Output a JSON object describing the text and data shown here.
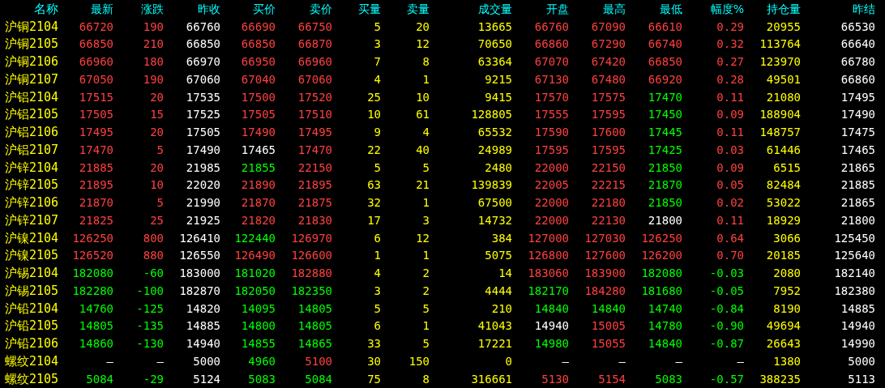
{
  "table": {
    "columns": [
      "名称",
      "最新",
      "涨跌",
      "昨收",
      "买价",
      "卖价",
      "买量",
      "卖量",
      "成交量",
      "开盘",
      "最高",
      "最低",
      "幅度%",
      "持仓量",
      "昨结"
    ],
    "rows": [
      {
        "cells": [
          {
            "text": "沪铜2104",
            "color": "#ffff00"
          },
          {
            "text": "66720",
            "color": "#ff4040"
          },
          {
            "text": "190",
            "color": "#ff4040"
          },
          {
            "text": "66760",
            "color": "#ffffff"
          },
          {
            "text": "66690",
            "color": "#ff4040"
          },
          {
            "text": "66750",
            "color": "#ff4040"
          },
          {
            "text": "5",
            "color": "#ffff00"
          },
          {
            "text": "20",
            "color": "#ffff00"
          },
          {
            "text": "13665",
            "color": "#ffff00"
          },
          {
            "text": "66760",
            "color": "#ff4040"
          },
          {
            "text": "67090",
            "color": "#ff4040"
          },
          {
            "text": "66610",
            "color": "#ff4040"
          },
          {
            "text": "0.29",
            "color": "#ff4040"
          },
          {
            "text": "20955",
            "color": "#ffff00"
          },
          {
            "text": "66530",
            "color": "#ffffff"
          }
        ]
      },
      {
        "cells": [
          {
            "text": "沪铜2105",
            "color": "#ffff00"
          },
          {
            "text": "66850",
            "color": "#ff4040"
          },
          {
            "text": "210",
            "color": "#ff4040"
          },
          {
            "text": "66850",
            "color": "#ffffff"
          },
          {
            "text": "66850",
            "color": "#ff4040"
          },
          {
            "text": "66870",
            "color": "#ff4040"
          },
          {
            "text": "3",
            "color": "#ffff00"
          },
          {
            "text": "12",
            "color": "#ffff00"
          },
          {
            "text": "70650",
            "color": "#ffff00"
          },
          {
            "text": "66860",
            "color": "#ff4040"
          },
          {
            "text": "67290",
            "color": "#ff4040"
          },
          {
            "text": "66740",
            "color": "#ff4040"
          },
          {
            "text": "0.32",
            "color": "#ff4040"
          },
          {
            "text": "113764",
            "color": "#ffff00"
          },
          {
            "text": "66640",
            "color": "#ffffff"
          }
        ]
      },
      {
        "cells": [
          {
            "text": "沪铜2106",
            "color": "#ffff00"
          },
          {
            "text": "66960",
            "color": "#ff4040"
          },
          {
            "text": "180",
            "color": "#ff4040"
          },
          {
            "text": "66970",
            "color": "#ffffff"
          },
          {
            "text": "66950",
            "color": "#ff4040"
          },
          {
            "text": "66960",
            "color": "#ff4040"
          },
          {
            "text": "7",
            "color": "#ffff00"
          },
          {
            "text": "8",
            "color": "#ffff00"
          },
          {
            "text": "63364",
            "color": "#ffff00"
          },
          {
            "text": "67070",
            "color": "#ff4040"
          },
          {
            "text": "67420",
            "color": "#ff4040"
          },
          {
            "text": "66850",
            "color": "#ff4040"
          },
          {
            "text": "0.27",
            "color": "#ff4040"
          },
          {
            "text": "123970",
            "color": "#ffff00"
          },
          {
            "text": "66780",
            "color": "#ffffff"
          }
        ]
      },
      {
        "cells": [
          {
            "text": "沪铜2107",
            "color": "#ffff00"
          },
          {
            "text": "67050",
            "color": "#ff4040"
          },
          {
            "text": "190",
            "color": "#ff4040"
          },
          {
            "text": "67060",
            "color": "#ffffff"
          },
          {
            "text": "67040",
            "color": "#ff4040"
          },
          {
            "text": "67060",
            "color": "#ff4040"
          },
          {
            "text": "4",
            "color": "#ffff00"
          },
          {
            "text": "1",
            "color": "#ffff00"
          },
          {
            "text": "9215",
            "color": "#ffff00"
          },
          {
            "text": "67130",
            "color": "#ff4040"
          },
          {
            "text": "67480",
            "color": "#ff4040"
          },
          {
            "text": "66920",
            "color": "#ff4040"
          },
          {
            "text": "0.28",
            "color": "#ff4040"
          },
          {
            "text": "49501",
            "color": "#ffff00"
          },
          {
            "text": "66860",
            "color": "#ffffff"
          }
        ]
      },
      {
        "cells": [
          {
            "text": "沪铝2104",
            "color": "#ffff00"
          },
          {
            "text": "17515",
            "color": "#ff4040"
          },
          {
            "text": "20",
            "color": "#ff4040"
          },
          {
            "text": "17535",
            "color": "#ffffff"
          },
          {
            "text": "17500",
            "color": "#ff4040"
          },
          {
            "text": "17520",
            "color": "#ff4040"
          },
          {
            "text": "25",
            "color": "#ffff00"
          },
          {
            "text": "10",
            "color": "#ffff00"
          },
          {
            "text": "9415",
            "color": "#ffff00"
          },
          {
            "text": "17570",
            "color": "#ff4040"
          },
          {
            "text": "17575",
            "color": "#ff4040"
          },
          {
            "text": "17470",
            "color": "#00ff00"
          },
          {
            "text": "0.11",
            "color": "#ff4040"
          },
          {
            "text": "21080",
            "color": "#ffff00"
          },
          {
            "text": "17495",
            "color": "#ffffff"
          }
        ]
      },
      {
        "cells": [
          {
            "text": "沪铝2105",
            "color": "#ffff00"
          },
          {
            "text": "17505",
            "color": "#ff4040"
          },
          {
            "text": "15",
            "color": "#ff4040"
          },
          {
            "text": "17525",
            "color": "#ffffff"
          },
          {
            "text": "17505",
            "color": "#ff4040"
          },
          {
            "text": "17510",
            "color": "#ff4040"
          },
          {
            "text": "10",
            "color": "#ffff00"
          },
          {
            "text": "61",
            "color": "#ffff00"
          },
          {
            "text": "128805",
            "color": "#ffff00"
          },
          {
            "text": "17555",
            "color": "#ff4040"
          },
          {
            "text": "17595",
            "color": "#ff4040"
          },
          {
            "text": "17450",
            "color": "#00ff00"
          },
          {
            "text": "0.09",
            "color": "#ff4040"
          },
          {
            "text": "188904",
            "color": "#ffff00"
          },
          {
            "text": "17490",
            "color": "#ffffff"
          }
        ]
      },
      {
        "cells": [
          {
            "text": "沪铝2106",
            "color": "#ffff00"
          },
          {
            "text": "17495",
            "color": "#ff4040"
          },
          {
            "text": "20",
            "color": "#ff4040"
          },
          {
            "text": "17505",
            "color": "#ffffff"
          },
          {
            "text": "17490",
            "color": "#ff4040"
          },
          {
            "text": "17495",
            "color": "#ff4040"
          },
          {
            "text": "9",
            "color": "#ffff00"
          },
          {
            "text": "4",
            "color": "#ffff00"
          },
          {
            "text": "65532",
            "color": "#ffff00"
          },
          {
            "text": "17590",
            "color": "#ff4040"
          },
          {
            "text": "17600",
            "color": "#ff4040"
          },
          {
            "text": "17445",
            "color": "#00ff00"
          },
          {
            "text": "0.11",
            "color": "#ff4040"
          },
          {
            "text": "148757",
            "color": "#ffff00"
          },
          {
            "text": "17475",
            "color": "#ffffff"
          }
        ]
      },
      {
        "cells": [
          {
            "text": "沪铝2107",
            "color": "#ffff00"
          },
          {
            "text": "17470",
            "color": "#ff4040"
          },
          {
            "text": "5",
            "color": "#ff4040"
          },
          {
            "text": "17490",
            "color": "#ffffff"
          },
          {
            "text": "17465",
            "color": "#ffffff"
          },
          {
            "text": "17470",
            "color": "#ff4040"
          },
          {
            "text": "22",
            "color": "#ffff00"
          },
          {
            "text": "40",
            "color": "#ffff00"
          },
          {
            "text": "24989",
            "color": "#ffff00"
          },
          {
            "text": "17595",
            "color": "#ff4040"
          },
          {
            "text": "17595",
            "color": "#ff4040"
          },
          {
            "text": "17425",
            "color": "#00ff00"
          },
          {
            "text": "0.03",
            "color": "#ff4040"
          },
          {
            "text": "61446",
            "color": "#ffff00"
          },
          {
            "text": "17465",
            "color": "#ffffff"
          }
        ]
      },
      {
        "cells": [
          {
            "text": "沪锌2104",
            "color": "#ffff00"
          },
          {
            "text": "21885",
            "color": "#ff4040"
          },
          {
            "text": "20",
            "color": "#ff4040"
          },
          {
            "text": "21985",
            "color": "#ffffff"
          },
          {
            "text": "21855",
            "color": "#00ff00"
          },
          {
            "text": "22150",
            "color": "#ff4040"
          },
          {
            "text": "5",
            "color": "#ffff00"
          },
          {
            "text": "5",
            "color": "#ffff00"
          },
          {
            "text": "2480",
            "color": "#ffff00"
          },
          {
            "text": "22000",
            "color": "#ff4040"
          },
          {
            "text": "22150",
            "color": "#ff4040"
          },
          {
            "text": "21850",
            "color": "#00ff00"
          },
          {
            "text": "0.09",
            "color": "#ff4040"
          },
          {
            "text": "6515",
            "color": "#ffff00"
          },
          {
            "text": "21865",
            "color": "#ffffff"
          }
        ]
      },
      {
        "cells": [
          {
            "text": "沪锌2105",
            "color": "#ffff00"
          },
          {
            "text": "21895",
            "color": "#ff4040"
          },
          {
            "text": "10",
            "color": "#ff4040"
          },
          {
            "text": "22020",
            "color": "#ffffff"
          },
          {
            "text": "21890",
            "color": "#ff4040"
          },
          {
            "text": "21895",
            "color": "#ff4040"
          },
          {
            "text": "63",
            "color": "#ffff00"
          },
          {
            "text": "21",
            "color": "#ffff00"
          },
          {
            "text": "139839",
            "color": "#ffff00"
          },
          {
            "text": "22005",
            "color": "#ff4040"
          },
          {
            "text": "22215",
            "color": "#ff4040"
          },
          {
            "text": "21870",
            "color": "#00ff00"
          },
          {
            "text": "0.05",
            "color": "#ff4040"
          },
          {
            "text": "82484",
            "color": "#ffff00"
          },
          {
            "text": "21885",
            "color": "#ffffff"
          }
        ]
      },
      {
        "cells": [
          {
            "text": "沪锌2106",
            "color": "#ffff00"
          },
          {
            "text": "21870",
            "color": "#ff4040"
          },
          {
            "text": "5",
            "color": "#ff4040"
          },
          {
            "text": "21990",
            "color": "#ffffff"
          },
          {
            "text": "21870",
            "color": "#ff4040"
          },
          {
            "text": "21875",
            "color": "#ff4040"
          },
          {
            "text": "32",
            "color": "#ffff00"
          },
          {
            "text": "1",
            "color": "#ffff00"
          },
          {
            "text": "67500",
            "color": "#ffff00"
          },
          {
            "text": "22000",
            "color": "#ff4040"
          },
          {
            "text": "22180",
            "color": "#ff4040"
          },
          {
            "text": "21850",
            "color": "#00ff00"
          },
          {
            "text": "0.02",
            "color": "#ff4040"
          },
          {
            "text": "53022",
            "color": "#ffff00"
          },
          {
            "text": "21865",
            "color": "#ffffff"
          }
        ]
      },
      {
        "cells": [
          {
            "text": "沪锌2107",
            "color": "#ffff00"
          },
          {
            "text": "21825",
            "color": "#ff4040"
          },
          {
            "text": "25",
            "color": "#ff4040"
          },
          {
            "text": "21925",
            "color": "#ffffff"
          },
          {
            "text": "21820",
            "color": "#ff4040"
          },
          {
            "text": "21830",
            "color": "#ff4040"
          },
          {
            "text": "17",
            "color": "#ffff00"
          },
          {
            "text": "3",
            "color": "#ffff00"
          },
          {
            "text": "14732",
            "color": "#ffff00"
          },
          {
            "text": "22000",
            "color": "#ff4040"
          },
          {
            "text": "22130",
            "color": "#ff4040"
          },
          {
            "text": "21800",
            "color": "#ffffff"
          },
          {
            "text": "0.11",
            "color": "#ff4040"
          },
          {
            "text": "18929",
            "color": "#ffff00"
          },
          {
            "text": "21800",
            "color": "#ffffff"
          }
        ]
      },
      {
        "cells": [
          {
            "text": "沪镍2104",
            "color": "#ffff00"
          },
          {
            "text": "126250",
            "color": "#ff4040"
          },
          {
            "text": "800",
            "color": "#ff4040"
          },
          {
            "text": "126410",
            "color": "#ffffff"
          },
          {
            "text": "122440",
            "color": "#00ff00"
          },
          {
            "text": "126970",
            "color": "#ff4040"
          },
          {
            "text": "6",
            "color": "#ffff00"
          },
          {
            "text": "12",
            "color": "#ffff00"
          },
          {
            "text": "384",
            "color": "#ffff00"
          },
          {
            "text": "127000",
            "color": "#ff4040"
          },
          {
            "text": "127030",
            "color": "#ff4040"
          },
          {
            "text": "126250",
            "color": "#ff4040"
          },
          {
            "text": "0.64",
            "color": "#ff4040"
          },
          {
            "text": "3066",
            "color": "#ffff00"
          },
          {
            "text": "125450",
            "color": "#ffffff"
          }
        ]
      },
      {
        "cells": [
          {
            "text": "沪镍2105",
            "color": "#ffff00"
          },
          {
            "text": "126520",
            "color": "#ff4040"
          },
          {
            "text": "880",
            "color": "#ff4040"
          },
          {
            "text": "126550",
            "color": "#ffffff"
          },
          {
            "text": "126490",
            "color": "#ff4040"
          },
          {
            "text": "126600",
            "color": "#ff4040"
          },
          {
            "text": "1",
            "color": "#ffff00"
          },
          {
            "text": "1",
            "color": "#ffff00"
          },
          {
            "text": "5075",
            "color": "#ffff00"
          },
          {
            "text": "126800",
            "color": "#ff4040"
          },
          {
            "text": "127600",
            "color": "#ff4040"
          },
          {
            "text": "126200",
            "color": "#ff4040"
          },
          {
            "text": "0.70",
            "color": "#ff4040"
          },
          {
            "text": "20185",
            "color": "#ffff00"
          },
          {
            "text": "125640",
            "color": "#ffffff"
          }
        ]
      },
      {
        "cells": [
          {
            "text": "沪锡2104",
            "color": "#ffff00"
          },
          {
            "text": "182080",
            "color": "#00ff00"
          },
          {
            "text": "-60",
            "color": "#00ff00"
          },
          {
            "text": "183000",
            "color": "#ffffff"
          },
          {
            "text": "181020",
            "color": "#00ff00"
          },
          {
            "text": "182880",
            "color": "#ff4040"
          },
          {
            "text": "4",
            "color": "#ffff00"
          },
          {
            "text": "2",
            "color": "#ffff00"
          },
          {
            "text": "14",
            "color": "#ffff00"
          },
          {
            "text": "183060",
            "color": "#ff4040"
          },
          {
            "text": "183900",
            "color": "#ff4040"
          },
          {
            "text": "182080",
            "color": "#00ff00"
          },
          {
            "text": "-0.03",
            "color": "#00ff00"
          },
          {
            "text": "2080",
            "color": "#ffff00"
          },
          {
            "text": "182140",
            "color": "#ffffff"
          }
        ]
      },
      {
        "cells": [
          {
            "text": "沪锡2105",
            "color": "#ffff00"
          },
          {
            "text": "182280",
            "color": "#00ff00"
          },
          {
            "text": "-100",
            "color": "#00ff00"
          },
          {
            "text": "182870",
            "color": "#ffffff"
          },
          {
            "text": "182050",
            "color": "#00ff00"
          },
          {
            "text": "182350",
            "color": "#00ff00"
          },
          {
            "text": "3",
            "color": "#ffff00"
          },
          {
            "text": "2",
            "color": "#ffff00"
          },
          {
            "text": "4444",
            "color": "#ffff00"
          },
          {
            "text": "182170",
            "color": "#00ff00"
          },
          {
            "text": "184280",
            "color": "#ff4040"
          },
          {
            "text": "181680",
            "color": "#00ff00"
          },
          {
            "text": "-0.05",
            "color": "#00ff00"
          },
          {
            "text": "7952",
            "color": "#ffff00"
          },
          {
            "text": "182380",
            "color": "#ffffff"
          }
        ]
      },
      {
        "cells": [
          {
            "text": "沪铅2104",
            "color": "#ffff00"
          },
          {
            "text": "14760",
            "color": "#00ff00"
          },
          {
            "text": "-125",
            "color": "#00ff00"
          },
          {
            "text": "14820",
            "color": "#ffffff"
          },
          {
            "text": "14095",
            "color": "#00ff00"
          },
          {
            "text": "14805",
            "color": "#00ff00"
          },
          {
            "text": "5",
            "color": "#ffff00"
          },
          {
            "text": "5",
            "color": "#ffff00"
          },
          {
            "text": "210",
            "color": "#ffff00"
          },
          {
            "text": "14840",
            "color": "#00ff00"
          },
          {
            "text": "14840",
            "color": "#00ff00"
          },
          {
            "text": "14740",
            "color": "#00ff00"
          },
          {
            "text": "-0.84",
            "color": "#00ff00"
          },
          {
            "text": "8190",
            "color": "#ffff00"
          },
          {
            "text": "14885",
            "color": "#ffffff"
          }
        ]
      },
      {
        "cells": [
          {
            "text": "沪铅2105",
            "color": "#ffff00"
          },
          {
            "text": "14805",
            "color": "#00ff00"
          },
          {
            "text": "-135",
            "color": "#00ff00"
          },
          {
            "text": "14885",
            "color": "#ffffff"
          },
          {
            "text": "14800",
            "color": "#00ff00"
          },
          {
            "text": "14805",
            "color": "#00ff00"
          },
          {
            "text": "6",
            "color": "#ffff00"
          },
          {
            "text": "1",
            "color": "#ffff00"
          },
          {
            "text": "41043",
            "color": "#ffff00"
          },
          {
            "text": "14940",
            "color": "#ffffff"
          },
          {
            "text": "15005",
            "color": "#ff4040"
          },
          {
            "text": "14780",
            "color": "#00ff00"
          },
          {
            "text": "-0.90",
            "color": "#00ff00"
          },
          {
            "text": "49694",
            "color": "#ffff00"
          },
          {
            "text": "14940",
            "color": "#ffffff"
          }
        ]
      },
      {
        "cells": [
          {
            "text": "沪铅2106",
            "color": "#ffff00"
          },
          {
            "text": "14860",
            "color": "#00ff00"
          },
          {
            "text": "-130",
            "color": "#00ff00"
          },
          {
            "text": "14940",
            "color": "#ffffff"
          },
          {
            "text": "14855",
            "color": "#00ff00"
          },
          {
            "text": "14865",
            "color": "#00ff00"
          },
          {
            "text": "33",
            "color": "#ffff00"
          },
          {
            "text": "5",
            "color": "#ffff00"
          },
          {
            "text": "17221",
            "color": "#ffff00"
          },
          {
            "text": "14980",
            "color": "#00ff00"
          },
          {
            "text": "15055",
            "color": "#ff4040"
          },
          {
            "text": "14840",
            "color": "#00ff00"
          },
          {
            "text": "-0.87",
            "color": "#00ff00"
          },
          {
            "text": "26643",
            "color": "#ffff00"
          },
          {
            "text": "14990",
            "color": "#ffffff"
          }
        ]
      },
      {
        "cells": [
          {
            "text": "螺纹2104",
            "color": "#ffff00"
          },
          {
            "text": "—",
            "color": "#ffffff"
          },
          {
            "text": "—",
            "color": "#ffffff"
          },
          {
            "text": "5000",
            "color": "#ffffff"
          },
          {
            "text": "4960",
            "color": "#00ff00"
          },
          {
            "text": "5100",
            "color": "#ff4040"
          },
          {
            "text": "30",
            "color": "#ffff00"
          },
          {
            "text": "150",
            "color": "#ffff00"
          },
          {
            "text": "0",
            "color": "#ffff00"
          },
          {
            "text": "—",
            "color": "#ffffff"
          },
          {
            "text": "—",
            "color": "#ffffff"
          },
          {
            "text": "—",
            "color": "#ffffff"
          },
          {
            "text": "—",
            "color": "#ffffff"
          },
          {
            "text": "1380",
            "color": "#ffff00"
          },
          {
            "text": "5000",
            "color": "#ffffff"
          }
        ]
      },
      {
        "cells": [
          {
            "text": "螺纹2105",
            "color": "#ffff00"
          },
          {
            "text": "5084",
            "color": "#00ff00"
          },
          {
            "text": "-29",
            "color": "#00ff00"
          },
          {
            "text": "5124",
            "color": "#ffffff"
          },
          {
            "text": "5083",
            "color": "#00ff00"
          },
          {
            "text": "5084",
            "color": "#00ff00"
          },
          {
            "text": "75",
            "color": "#ffff00"
          },
          {
            "text": "8",
            "color": "#ffff00"
          },
          {
            "text": "316661",
            "color": "#ffff00"
          },
          {
            "text": "5130",
            "color": "#ff4040"
          },
          {
            "text": "5154",
            "color": "#ff4040"
          },
          {
            "text": "5083",
            "color": "#00ff00"
          },
          {
            "text": "-0.57",
            "color": "#00ff00"
          },
          {
            "text": "388235",
            "color": "#ffff00"
          },
          {
            "text": "5113",
            "color": "#ffffff"
          }
        ]
      }
    ]
  }
}
